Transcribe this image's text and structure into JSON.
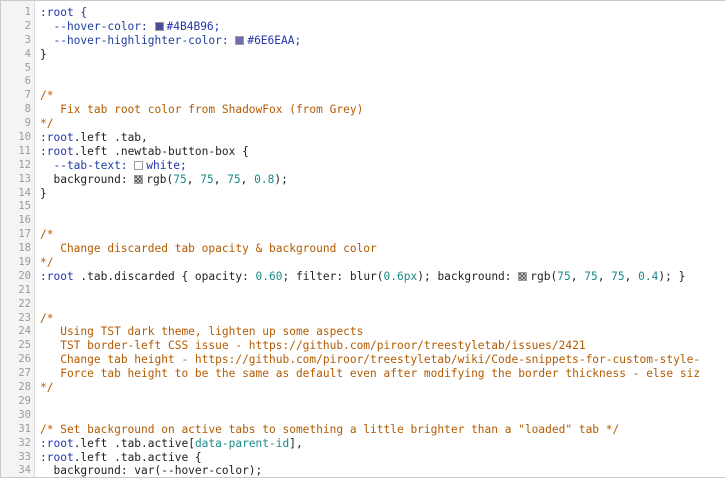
{
  "lines": [
    {
      "n": "1",
      "segs": [
        {
          "t": ":root {",
          "c": "kw"
        }
      ]
    },
    {
      "n": "2",
      "segs": [
        {
          "t": "  --hover-color: ",
          "c": "prop"
        },
        {
          "sw": "#4B4B96"
        },
        {
          "t": "#4B4B96;",
          "c": "kw"
        }
      ]
    },
    {
      "n": "3",
      "segs": [
        {
          "t": "  --hover-highlighter-color: ",
          "c": "prop"
        },
        {
          "sw": "#6E6EAA"
        },
        {
          "t": "#6E6EAA;",
          "c": "kw"
        }
      ]
    },
    {
      "n": "4",
      "segs": [
        {
          "t": "}",
          "c": "str"
        }
      ]
    },
    {
      "n": "5",
      "segs": []
    },
    {
      "n": "6",
      "segs": []
    },
    {
      "n": "7",
      "segs": [
        {
          "t": "/*",
          "c": "com"
        }
      ]
    },
    {
      "n": "8",
      "segs": [
        {
          "t": "   Fix tab root color from ShadowFox (from Grey)",
          "c": "com"
        }
      ]
    },
    {
      "n": "9",
      "segs": [
        {
          "t": "*/",
          "c": "com"
        }
      ]
    },
    {
      "n": "10",
      "segs": [
        {
          "t": ":root",
          "c": "kw"
        },
        {
          "t": ".left .tab,",
          "c": "str"
        }
      ]
    },
    {
      "n": "11",
      "segs": [
        {
          "t": ":root",
          "c": "kw"
        },
        {
          "t": ".left .newtab-button-box {",
          "c": "str"
        }
      ]
    },
    {
      "n": "12",
      "segs": [
        {
          "t": "  --tab-text: ",
          "c": "prop"
        },
        {
          "sw": "white"
        },
        {
          "t": "white;",
          "c": "kw"
        }
      ]
    },
    {
      "n": "13",
      "segs": [
        {
          "t": "  background: ",
          "c": "str"
        },
        {
          "sw": "checker"
        },
        {
          "t": "rgb(",
          "c": "str"
        },
        {
          "t": "75",
          "c": "num"
        },
        {
          "t": ", ",
          "c": "str"
        },
        {
          "t": "75",
          "c": "num"
        },
        {
          "t": ", ",
          "c": "str"
        },
        {
          "t": "75",
          "c": "num"
        },
        {
          "t": ", ",
          "c": "str"
        },
        {
          "t": "0.8",
          "c": "num"
        },
        {
          "t": ");",
          "c": "str"
        }
      ]
    },
    {
      "n": "14",
      "segs": [
        {
          "t": "}",
          "c": "str"
        }
      ]
    },
    {
      "n": "15",
      "segs": []
    },
    {
      "n": "16",
      "segs": []
    },
    {
      "n": "17",
      "segs": [
        {
          "t": "/*",
          "c": "com"
        }
      ]
    },
    {
      "n": "18",
      "segs": [
        {
          "t": "   Change discarded tab opacity & background color",
          "c": "com"
        }
      ]
    },
    {
      "n": "19",
      "segs": [
        {
          "t": "*/",
          "c": "com"
        }
      ]
    },
    {
      "n": "20",
      "segs": [
        {
          "t": ":root",
          "c": "kw"
        },
        {
          "t": " .tab.discarded { opacity: ",
          "c": "str"
        },
        {
          "t": "0.60",
          "c": "num"
        },
        {
          "t": "; filter: blur(",
          "c": "str"
        },
        {
          "t": "0.6px",
          "c": "num"
        },
        {
          "t": "); background: ",
          "c": "str"
        },
        {
          "sw": "checker"
        },
        {
          "t": "rgb(",
          "c": "str"
        },
        {
          "t": "75",
          "c": "num"
        },
        {
          "t": ", ",
          "c": "str"
        },
        {
          "t": "75",
          "c": "num"
        },
        {
          "t": ", ",
          "c": "str"
        },
        {
          "t": "75",
          "c": "num"
        },
        {
          "t": ", ",
          "c": "str"
        },
        {
          "t": "0.4",
          "c": "num"
        },
        {
          "t": "); }",
          "c": "str"
        }
      ]
    },
    {
      "n": "21",
      "segs": []
    },
    {
      "n": "22",
      "segs": []
    },
    {
      "n": "23",
      "segs": [
        {
          "t": "/*",
          "c": "com"
        }
      ]
    },
    {
      "n": "24",
      "segs": [
        {
          "t": "   Using TST dark theme, lighten up some aspects",
          "c": "com"
        }
      ]
    },
    {
      "n": "25",
      "segs": [
        {
          "t": "   TST border-left CSS issue - https://github.com/piroor/treestyletab/issues/2421",
          "c": "com"
        }
      ]
    },
    {
      "n": "26",
      "segs": [
        {
          "t": "   Change tab height - https://github.com/piroor/treestyletab/wiki/Code-snippets-for-custom-style-",
          "c": "com"
        }
      ]
    },
    {
      "n": "27",
      "segs": [
        {
          "t": "   Force tab height to be the same as default even after modifying the border thickness - else siz",
          "c": "com"
        }
      ]
    },
    {
      "n": "28",
      "segs": [
        {
          "t": "*/",
          "c": "com"
        }
      ]
    },
    {
      "n": "29",
      "segs": []
    },
    {
      "n": "30",
      "segs": []
    },
    {
      "n": "31",
      "segs": [
        {
          "t": "/* Set background on active tabs to something a little brighter than a \"loaded\" tab */",
          "c": "com"
        }
      ]
    },
    {
      "n": "32",
      "segs": [
        {
          "t": ":root",
          "c": "kw"
        },
        {
          "t": ".left .tab.active[",
          "c": "str"
        },
        {
          "t": "data-parent-id",
          "c": "num"
        },
        {
          "t": "],",
          "c": "str"
        }
      ]
    },
    {
      "n": "33",
      "segs": [
        {
          "t": ":root",
          "c": "kw"
        },
        {
          "t": ".left .tab.active {",
          "c": "str"
        }
      ]
    },
    {
      "n": "34",
      "segs": [
        {
          "t": "  background: var(--hover-color);",
          "c": "str"
        }
      ]
    }
  ]
}
